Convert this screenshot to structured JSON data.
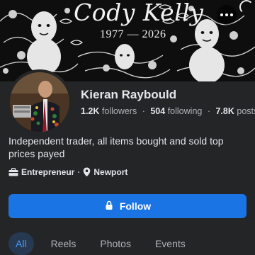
{
  "cover": {
    "title": "Cody Kelly",
    "dates": "1977 — 2026",
    "more_icon": "ellipsis-icon"
  },
  "profile": {
    "name": "Kieran Raybould",
    "followers_count": "1.2K",
    "followers_label": "followers",
    "following_count": "504",
    "following_label": "following",
    "posts_count": "7.8K",
    "posts_label": "posts",
    "bio": "Independent trader, all items bought and sold top prices payed",
    "category": "Entrepreneur",
    "location": "Newport",
    "separator": "·"
  },
  "actions": {
    "follow_label": "Follow"
  },
  "tabs": [
    {
      "label": "All",
      "active": true
    },
    {
      "label": "Reels",
      "active": false
    },
    {
      "label": "Photos",
      "active": false
    },
    {
      "label": "Events",
      "active": false
    }
  ],
  "colors": {
    "accent": "#1b74e4",
    "active_tab_text": "#4599ff",
    "background": "#242526"
  }
}
